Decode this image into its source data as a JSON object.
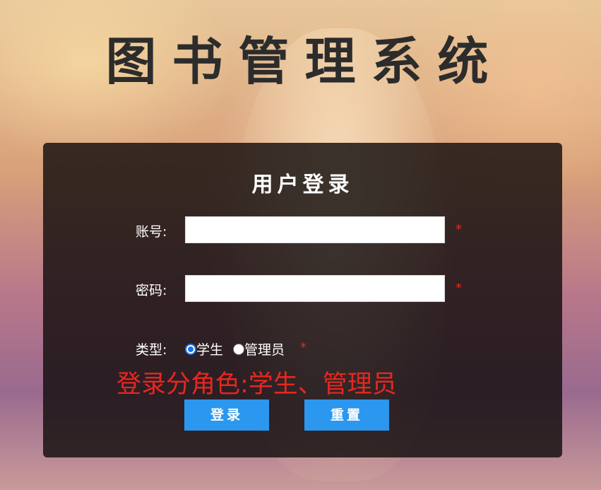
{
  "page_title": "图书管理系统",
  "login_panel": {
    "heading": "用户登录",
    "account_label": "账号:",
    "account_value": "",
    "password_label": "密码:",
    "password_value": "",
    "required_mark": "*",
    "type_label": "类型:",
    "type_options": [
      {
        "label": "学生",
        "selected": true
      },
      {
        "label": "管理员",
        "selected": false
      }
    ],
    "note": "登录分角色:学生、管理员",
    "login_button": "登录",
    "reset_button": "重置"
  },
  "colors": {
    "title_text": "#2c2c2c",
    "panel_bg": "#120e0e",
    "required_red": "#e8271e",
    "button_blue": "#2b97ee",
    "radio_blue": "#1a73e8"
  }
}
